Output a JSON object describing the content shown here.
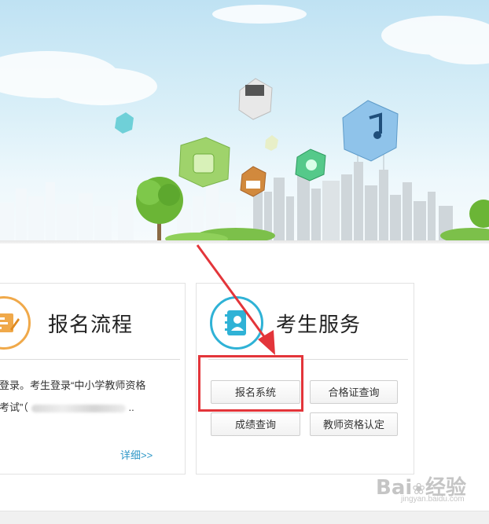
{
  "left_panel": {
    "title": "报名流程",
    "desc_line1": "登录。考生登录“中小学教师资格",
    "desc_line2_prefix": "考试”（",
    "desc_line2_suffix": "..",
    "more_link": "详细>>"
  },
  "right_panel": {
    "title": "考生服务",
    "buttons": [
      {
        "label": "报名系统"
      },
      {
        "label": "合格证查询"
      },
      {
        "label": "成绩查询"
      },
      {
        "label": "教师资格认定"
      }
    ]
  },
  "watermark": {
    "brand": "Bai",
    "brand_suffix": "经验",
    "url": "jingyan.baidu.com"
  },
  "colors": {
    "accent_orange": "#f0a94a",
    "accent_cyan": "#2fb2d6",
    "link_blue": "#2e97c7",
    "annotation_red": "#e3353a"
  },
  "icons": [
    "certificate-icon",
    "address-book-icon",
    "red-arrow",
    "baidu-paw-icon"
  ]
}
